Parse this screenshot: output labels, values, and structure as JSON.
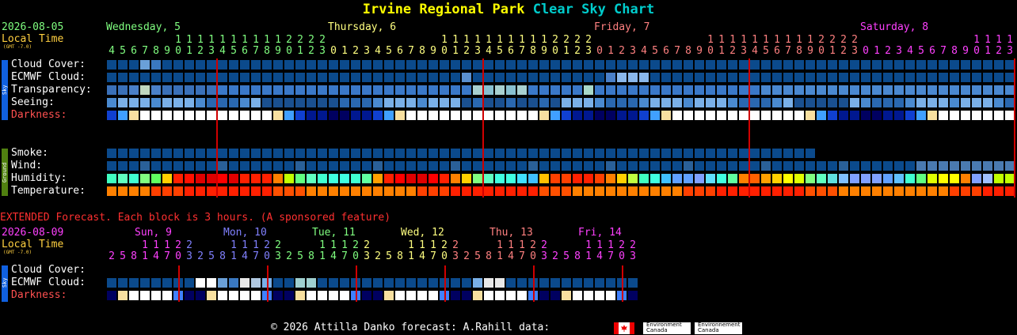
{
  "title": {
    "location": "Irvine Regional Park",
    "suffix": "Clear Sky Chart"
  },
  "colors": {
    "location": "#ffff00",
    "suffix": "#00cccc"
  },
  "main": {
    "date": "2026-08-05",
    "local_time": "Local Time",
    "gmt": "(GMT -7.0)",
    "days": [
      {
        "label": "Wednesday, 5",
        "color": "#80ff80"
      },
      {
        "label": "Thursday, 6",
        "color": "#ffff80"
      },
      {
        "label": "Friday, 7",
        "color": "#ff8080"
      },
      {
        "label": "Saturday, 8",
        "color": "#ff40ff"
      }
    ],
    "sky_rows": [
      {
        "label": "Cloud Cover:",
        "color": "#ffffff"
      },
      {
        "label": "ECMWF Cloud:",
        "color": "#ffffff"
      },
      {
        "label": "Transparency:",
        "color": "#ffffff"
      },
      {
        "label": "Seeing:",
        "color": "#ffffff"
      },
      {
        "label": "Darkness:",
        "color": "#ff5050"
      }
    ],
    "ground_rows": [
      {
        "label": "Smoke:",
        "color": "#ffffff"
      },
      {
        "label": "Wind:",
        "color": "#ffffff"
      },
      {
        "label": "Humidity:",
        "color": "#ffffff"
      },
      {
        "label": "Temperature:",
        "color": "#ffffff"
      }
    ],
    "sky_sidebar": "Sky",
    "ground_sidebar": "Ground"
  },
  "extended": {
    "heading": "EXTENDED Forecast. Each block is 3 hours. (A sponsored feature)",
    "date": "2026-08-09",
    "local_time": "Local Time",
    "gmt": "(GMT -7.0)",
    "days": [
      {
        "label": "Sun, 9",
        "color": "#ff40ff"
      },
      {
        "label": "Mon, 10",
        "color": "#8080ff"
      },
      {
        "label": "Tue, 11",
        "color": "#80ff80"
      },
      {
        "label": "Wed, 12",
        "color": "#ffff80"
      },
      {
        "label": "Thu, 13",
        "color": "#ff8080"
      },
      {
        "label": "Fri, 14",
        "color": "#ff40ff"
      }
    ],
    "rows": [
      {
        "label": "Cloud Cover:",
        "color": "#ffffff"
      },
      {
        "label": "ECMWF Cloud:",
        "color": "#ffffff"
      },
      {
        "label": "Darkness:",
        "color": "#ff5050"
      }
    ],
    "sidebar": "Sky"
  },
  "footer": {
    "text": "© 2026 Attilla Danko  forecast: A.Rahill  data:",
    "logo1": "Environment Canada",
    "logo2": "Environnement Canada"
  }
}
